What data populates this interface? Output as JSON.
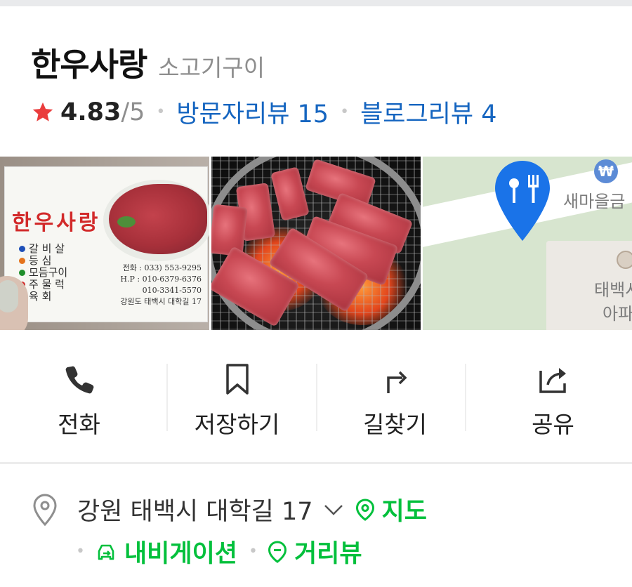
{
  "place": {
    "name": "한우사랑",
    "category": "소고기구이"
  },
  "rating": {
    "value": "4.83",
    "max": "/5",
    "visitor_reviews_label": "방문자리뷰 15",
    "blog_reviews_label": "블로그리뷰 4"
  },
  "photos": {
    "card": {
      "title": "한우사랑",
      "menu": [
        "갈 비 살",
        "등   심",
        "모듬구이",
        "주 물 럭",
        "육   회"
      ],
      "menu_bullet_colors": [
        "#1e4fb8",
        "#e4731c",
        "#1f8f2c",
        "#d22a2a",
        "#1e4fb8"
      ],
      "phone": "전화 : 033) 553-9295",
      "hp": "H.P : 010-6379-6376",
      "hp2": "010-3341-5570",
      "address": "강원도 태백시 대학길 17"
    },
    "map": {
      "poi_label": "새마을금",
      "apt_label_1": "태백시",
      "apt_label_2": "아파",
      "won_symbol": "₩"
    }
  },
  "actions": [
    {
      "label": "전화",
      "icon": "phone-icon"
    },
    {
      "label": "저장하기",
      "icon": "bookmark-icon"
    },
    {
      "label": "길찾기",
      "icon": "directions-icon"
    },
    {
      "label": "공유",
      "icon": "share-icon"
    }
  ],
  "address": {
    "text": "강원 태백시 대학길 17",
    "map_label": "지도",
    "navigation_label": "내비게이션",
    "streetview_label": "거리뷰"
  },
  "colors": {
    "accent_green": "#03c03c",
    "link_blue": "#1565c0",
    "star_red": "#ea3d3d",
    "pin_blue": "#1a73e8"
  }
}
